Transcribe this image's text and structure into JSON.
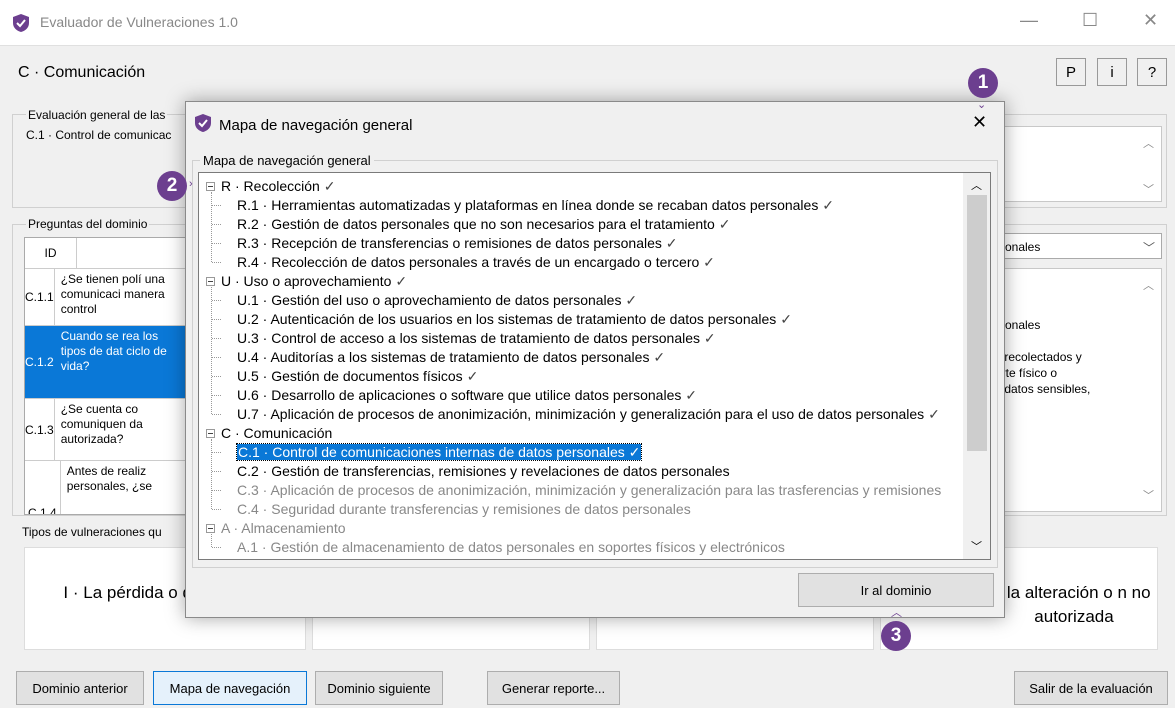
{
  "window": {
    "title": "Evaluador de Vulneraciones 1.0",
    "minimize": "—",
    "maximize": "☐",
    "close": "✕"
  },
  "domain_title": "C · Comunicación",
  "top_buttons": {
    "p": "P",
    "i": "i",
    "help": "?"
  },
  "general": {
    "label": "Evaluación general de las",
    "value": "C.1 · Control de comunicac"
  },
  "questions": {
    "label": "Preguntas del dominio",
    "col_id": "ID",
    "rows": [
      {
        "id": "C.1.1",
        "text": "¿Se tienen polí una comunicaci manera control"
      },
      {
        "id": "C.1.2",
        "text": "Cuando se rea los tipos de dat ciclo de vida?"
      },
      {
        "id": "C.1.3",
        "text": "¿Se cuenta co comuniquen da autorizada?"
      },
      {
        "id": "C.1.4",
        "text": "Antes de realiz personales, ¿se"
      }
    ]
  },
  "right_panel": {
    "dropdown": "rsonales",
    "text1": "rsonales",
    "text2": "s recolectados y",
    "text3": "orte físico o",
    "text4": "s datos sensibles,"
  },
  "vulnerabilities": {
    "label": "Tipos de vulneraciones qu",
    "box1": "I · La pérdida o de autoriza",
    "box4": ", la alteración o n no autorizada"
  },
  "bottom_buttons": {
    "prev": "Dominio anterior",
    "map": "Mapa de navegación",
    "next": "Dominio siguiente",
    "report": "Generar reporte...",
    "exit": "Salir de la evaluación"
  },
  "dialog": {
    "title": "Mapa de navegación general",
    "close": "✕",
    "tree_label": "Mapa de navegación general",
    "go_button": "Ir al dominio",
    "tree": [
      {
        "text": "R · Recolección",
        "check": "✓",
        "level": 0
      },
      {
        "text": "R.1 · Herramientas automatizadas y plataformas en línea donde se recaban datos personales",
        "check": "✓",
        "level": 1
      },
      {
        "text": "R.2 · Gestión de datos personales que no son necesarios para el tratamiento",
        "check": "✓",
        "level": 1
      },
      {
        "text": "R.3 · Recepción de transferencias o remisiones de datos personales",
        "check": "✓",
        "level": 1
      },
      {
        "text": "R.4 · Recolección de datos personales a través de un encargado o tercero",
        "check": "✓",
        "level": 1
      },
      {
        "text": "U · Uso o aprovechamiento",
        "check": "✓",
        "level": 0
      },
      {
        "text": "U.1 · Gestión del uso o aprovechamiento de datos personales",
        "check": "✓",
        "level": 1
      },
      {
        "text": "U.2 · Autenticación de los usuarios en los sistemas de tratamiento de datos personales",
        "check": "✓",
        "level": 1
      },
      {
        "text": "U.3 · Control de acceso a los sistemas de tratamiento de datos personales",
        "check": "✓",
        "level": 1
      },
      {
        "text": "U.4 · Auditorías a los sistemas de tratamiento de datos personales",
        "check": "✓",
        "level": 1
      },
      {
        "text": "U.5 · Gestión de documentos físicos",
        "check": "✓",
        "level": 1
      },
      {
        "text": "U.6 · Desarrollo de aplicaciones o software que utilice datos personales",
        "check": "✓",
        "level": 1
      },
      {
        "text": "U.7 · Aplicación de procesos de anonimización, minimización y generalización para el uso de datos personales",
        "check": "✓",
        "level": 1
      },
      {
        "text": "C · Comunicación",
        "check": "",
        "level": 0
      },
      {
        "text": "C.1 · Control de comunicaciones internas de datos personales",
        "check": "✓",
        "level": 1,
        "selected": true
      },
      {
        "text": "C.2 · Gestión de transferencias, remisiones y revelaciones de datos personales",
        "check": "",
        "level": 1
      },
      {
        "text": "C.3 · Aplicación de procesos de anonimización, minimización y generalización para las trasferencias y remisiones",
        "check": "",
        "level": 1,
        "disabled": true
      },
      {
        "text": "C.4 · Seguridad durante transferencias y remisiones de datos personales",
        "check": "",
        "level": 1,
        "disabled": true
      },
      {
        "text": "A · Almacenamiento",
        "check": "",
        "level": 0,
        "disabled": true
      },
      {
        "text": "A.1 · Gestión de almacenamiento de datos personales en soportes físicos y electrónicos",
        "check": "",
        "level": 1,
        "disabled": true
      }
    ]
  },
  "badges": {
    "b1": "1",
    "b2": "2",
    "b3": "3"
  },
  "colors": {
    "accent": "#0a78d7",
    "badge": "#6c3f8f"
  }
}
